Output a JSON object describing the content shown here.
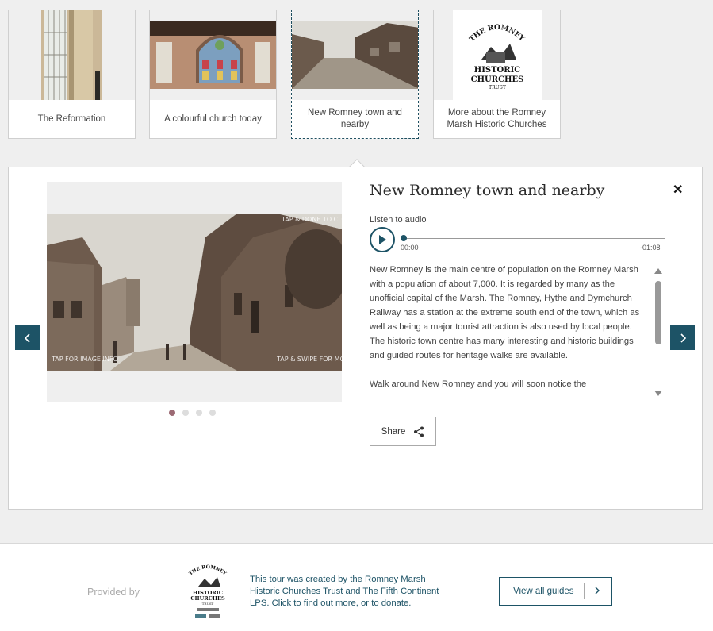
{
  "thumbnails": [
    {
      "caption": "The Reformation"
    },
    {
      "caption": "A colourful church today"
    },
    {
      "caption": "New Romney town and nearby",
      "active": true
    },
    {
      "caption": "More about the Romney Marsh Historic Churches"
    }
  ],
  "logo_text": {
    "line1": "THE ROMNEY MARSH",
    "line2": "HISTORIC",
    "line3": "CHURCHES",
    "line4": "TRUST"
  },
  "photo_overlay": {
    "tap_done": "TAP & DONE TO CLOSE PHOTOS",
    "tap_info": "TAP FOR IMAGE INFO",
    "tap_swipe": "TAP & SWIPE FOR MORE IMAGES"
  },
  "detail": {
    "title": "New Romney town and nearby",
    "listen_label": "Listen to audio",
    "time_current": "00:00",
    "time_remaining": "-01:08",
    "paragraphs": [
      "New Romney is the main centre of population on the Romney Marsh with a population of about 7,000. It is regarded by many as the unofficial capital of the Marsh. The Romney, Hythe and Dymchurch Railway has a station at the extreme south end of the town, which as well as being a major tourist attraction is also used by local people. The historic town centre has many interesting and historic buildings and guided routes for heritage walks are available.",
      "Walk around New Romney and you will soon notice the"
    ],
    "share_label": "Share",
    "image_count": 4
  },
  "footer": {
    "provided_by": "Provided by",
    "credit_text": "This tour was created by the Romney Marsh Historic Churches Trust and The Fifth Continent LPS. Click to find out more, or to donate.",
    "view_all_label": "View all guides"
  },
  "colors": {
    "accent": "#1d5366",
    "active_dot": "#9c6a74",
    "background": "#efefef"
  }
}
